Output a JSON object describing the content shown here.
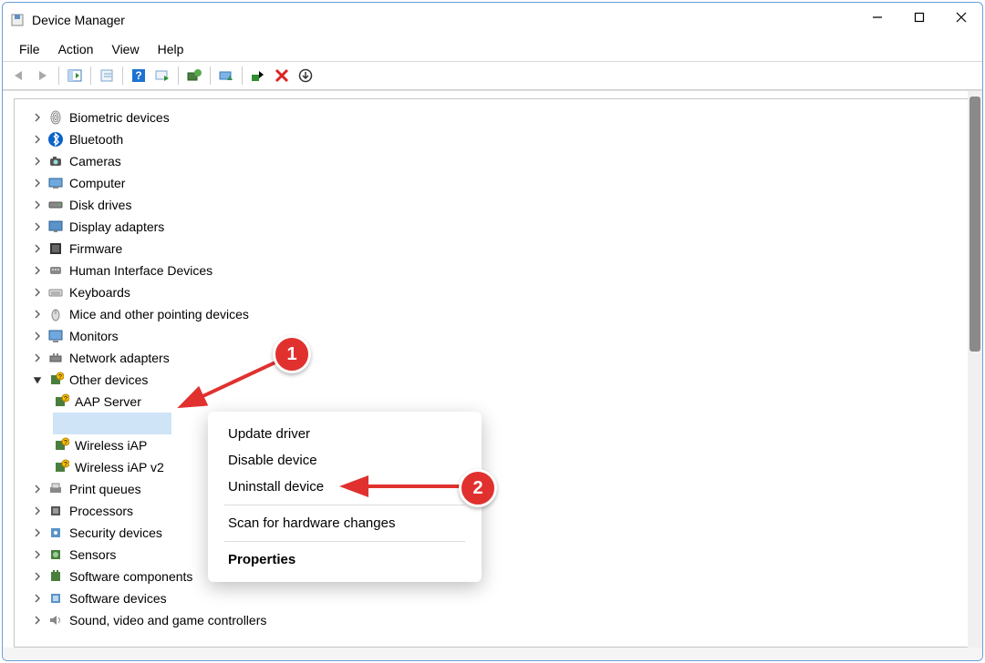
{
  "title": "Device Manager",
  "menu": [
    "File",
    "Action",
    "View",
    "Help"
  ],
  "tree": [
    {
      "label": "Biometric devices",
      "icon": "finger"
    },
    {
      "label": "Bluetooth",
      "icon": "bt"
    },
    {
      "label": "Cameras",
      "icon": "cam"
    },
    {
      "label": "Computer",
      "icon": "pc"
    },
    {
      "label": "Disk drives",
      "icon": "disk"
    },
    {
      "label": "Display adapters",
      "icon": "disp"
    },
    {
      "label": "Firmware",
      "icon": "fw"
    },
    {
      "label": "Human Interface Devices",
      "icon": "hid"
    },
    {
      "label": "Keyboards",
      "icon": "kb"
    },
    {
      "label": "Mice and other pointing devices",
      "icon": "mouse"
    },
    {
      "label": "Monitors",
      "icon": "mon"
    },
    {
      "label": "Network adapters",
      "icon": "net"
    },
    {
      "label": "Other devices",
      "icon": "other",
      "expanded": true,
      "children": [
        {
          "label": "AAP Server",
          "icon": "unk"
        },
        {
          "label": "",
          "icon": "none",
          "selected": true
        },
        {
          "label": "Wireless iAP",
          "icon": "unk"
        },
        {
          "label": "Wireless iAP v2",
          "icon": "unk",
          "truncated": true
        }
      ]
    },
    {
      "label": "Print queues",
      "icon": "print"
    },
    {
      "label": "Processors",
      "icon": "cpu"
    },
    {
      "label": "Security devices",
      "icon": "sec"
    },
    {
      "label": "Sensors",
      "icon": "sens"
    },
    {
      "label": "Software components",
      "icon": "swc"
    },
    {
      "label": "Software devices",
      "icon": "swd"
    },
    {
      "label": "Sound, video and game controllers",
      "icon": "snd"
    }
  ],
  "contextMenu": {
    "items": [
      {
        "label": "Update driver"
      },
      {
        "label": "Disable device"
      },
      {
        "label": "Uninstall device"
      },
      {
        "sep": true
      },
      {
        "label": "Scan for hardware changes"
      },
      {
        "sep": true
      },
      {
        "label": "Properties",
        "bold": true
      }
    ]
  },
  "annotations": [
    {
      "num": "1"
    },
    {
      "num": "2"
    }
  ]
}
